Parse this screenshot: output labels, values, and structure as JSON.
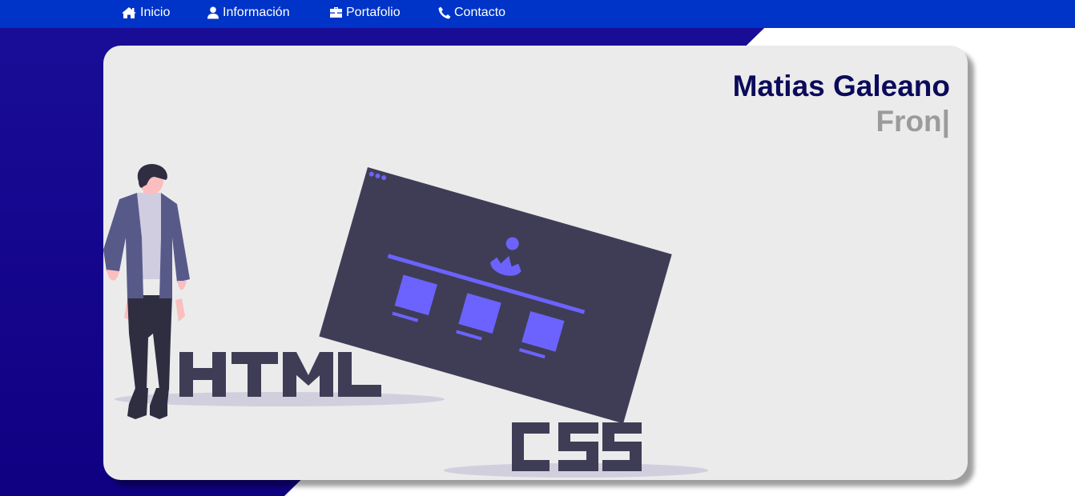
{
  "nav": {
    "items": [
      {
        "label": "Inicio",
        "icon": "home-icon"
      },
      {
        "label": "Información",
        "icon": "user-icon"
      },
      {
        "label": "Portafolio",
        "icon": "briefcase-icon"
      },
      {
        "label": "Contacto",
        "icon": "phone-icon"
      }
    ]
  },
  "hero": {
    "name": "Matias Galeano",
    "typing_text": "Fron|"
  },
  "colors": {
    "navbar": "#0033c7",
    "background_accent": "#100082",
    "card": "#ebebeb",
    "name": "#0c0a5a",
    "typing": "#9b9b9b",
    "illustration_dark": "#3f3d56",
    "illustration_accent": "#6c63ff"
  }
}
